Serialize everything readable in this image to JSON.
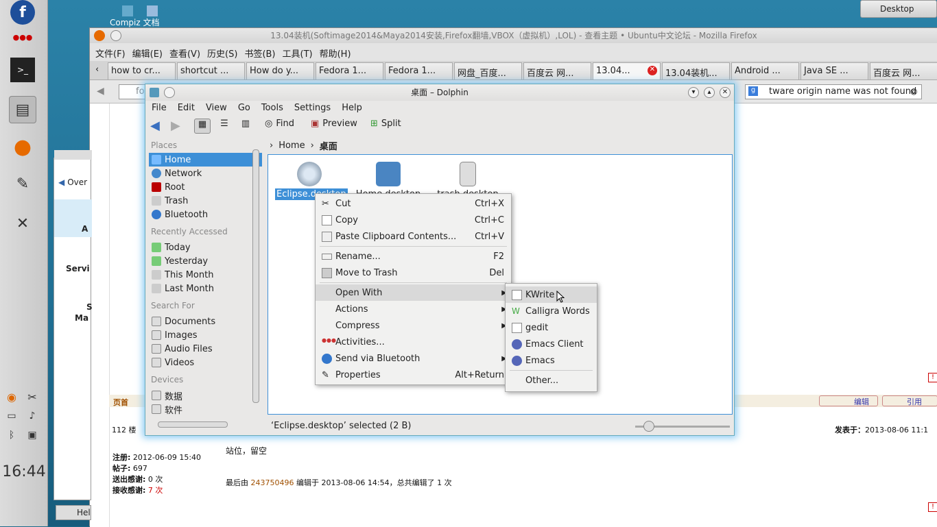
{
  "desktop": {
    "button": "Desktop",
    "icon_label": "Compiz 文档"
  },
  "panel": {
    "clock": "16:44"
  },
  "firefox": {
    "title": "13.04装机(Softimage2014&Maya2014安装,Firefox翻墙,VBOX（虚拟机）,LOL) - 查看主题 • Ubuntu中文论坛 - Mozilla Firefox",
    "menu": [
      "文件(F)",
      "编辑(E)",
      "查看(V)",
      "历史(S)",
      "书签(B)",
      "工具(T)",
      "帮助(H)"
    ],
    "tabs": [
      "how to cr...",
      "shortcut ...",
      "How do y...",
      "Fedora 1...",
      "Fedora 1...",
      "网盘_百度...",
      "百度云 网...",
      "13.04...",
      "13.04装机...",
      "Android ...",
      "Java SE ...",
      "百度云 网..."
    ],
    "url_fragment": "fo",
    "search_text": "tware origin name was not found"
  },
  "forum": {
    "page_top": "页首",
    "edit": "编辑",
    "quote": "引用",
    "floor": "112 楼",
    "posted_prefix": "发表于：",
    "posted_at": "2013-08-06 11:1",
    "reg_label": "注册:",
    "reg_value": "2012-06-09 15:40",
    "posts_label": "帖子:",
    "posts_value": "697",
    "thanks_out_label": "送出感谢:",
    "thanks_out_value": "0 次",
    "thanks_in_label": "接收感谢:",
    "thanks_in_value": "7 次",
    "body": "站位，留空",
    "edited_prefix": "最后由 ",
    "edited_user": "243750496",
    "edited_suffix": " 编辑于 2013-08-06 14:54，总共编辑了 1 次"
  },
  "left_window": {
    "back": "Over",
    "a": "A",
    "service": "Servi",
    "s": "S",
    "ma": "Ma",
    "help": "Hel"
  },
  "dolphin": {
    "title": "桌面 – Dolphin",
    "menu": [
      "File",
      "Edit",
      "View",
      "Go",
      "Tools",
      "Settings",
      "Help"
    ],
    "toolbar": {
      "find": "Find",
      "preview": "Preview",
      "split": "Split"
    },
    "places_header": "Places",
    "places": [
      "Home",
      "Network",
      "Root",
      "Trash",
      "Bluetooth"
    ],
    "recent_header": "Recently Accessed",
    "recent": [
      "Today",
      "Yesterday",
      "This Month",
      "Last Month"
    ],
    "search_header": "Search For",
    "search": [
      "Documents",
      "Images",
      "Audio Files",
      "Videos"
    ],
    "devices_header": "Devices",
    "devices": [
      "数据",
      "软件"
    ],
    "breadcrumb": [
      "Home",
      "桌面"
    ],
    "files": [
      "Eclipse.desktop",
      "Home.desktop",
      "trash.desktop"
    ],
    "status": "‘Eclipse.desktop’ selected (2 B)"
  },
  "context_menu": {
    "items": [
      {
        "label": "Cut",
        "shortcut": "Ctrl+X"
      },
      {
        "label": "Copy",
        "shortcut": "Ctrl+C"
      },
      {
        "label": "Paste Clipboard Contents...",
        "shortcut": "Ctrl+V"
      },
      {
        "label": "Rename...",
        "shortcut": "F2"
      },
      {
        "label": "Move to Trash",
        "shortcut": "Del"
      },
      {
        "label": "Open With",
        "shortcut": ""
      },
      {
        "label": "Actions",
        "shortcut": ""
      },
      {
        "label": "Compress",
        "shortcut": ""
      },
      {
        "label": "Activities...",
        "shortcut": ""
      },
      {
        "label": "Send via Bluetooth",
        "shortcut": ""
      },
      {
        "label": "Properties",
        "shortcut": "Alt+Return"
      }
    ]
  },
  "open_with_menu": {
    "items": [
      "KWrite",
      "Calligra Words",
      "gedit",
      "Emacs Client",
      "Emacs",
      "Other..."
    ]
  }
}
